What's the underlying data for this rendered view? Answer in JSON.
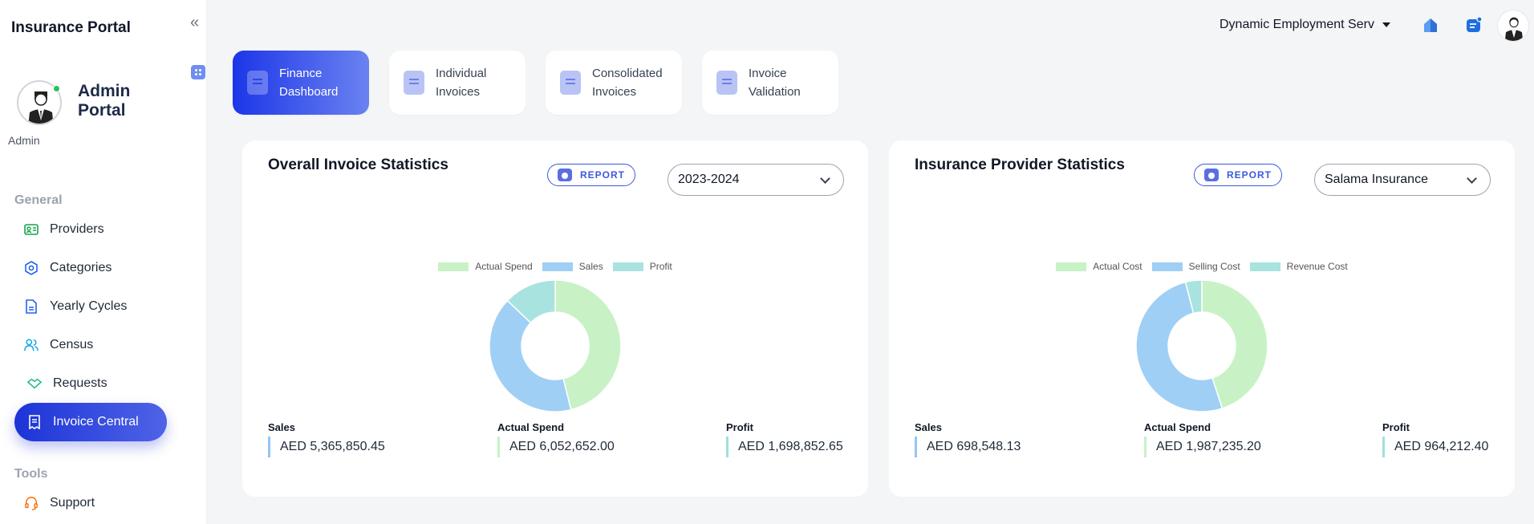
{
  "sidebar": {
    "app_title": "Insurance Portal",
    "user_name": "Admin Portal",
    "user_role": "Admin",
    "sections": [
      {
        "label": "General"
      },
      {
        "label": "Tools"
      }
    ],
    "items": [
      {
        "label": "Providers",
        "icon": "id-card-icon",
        "color": "#16a34a"
      },
      {
        "label": "Categories",
        "icon": "hexagon-icon",
        "color": "#2563eb"
      },
      {
        "label": "Yearly Cycles",
        "icon": "document-icon",
        "color": "#2563eb"
      },
      {
        "label": "Census",
        "icon": "users-icon",
        "color": "#0ea5e9"
      },
      {
        "label": "Requests",
        "icon": "handshake-icon",
        "color": "#10b981"
      },
      {
        "label": "Invoice Central",
        "icon": "invoice-icon",
        "active": true
      },
      {
        "label": "Support",
        "icon": "headset-icon",
        "color": "#f97316"
      }
    ]
  },
  "header": {
    "company": "Dynamic Employment Serv"
  },
  "tabs": [
    {
      "label": "Finance Dashboard",
      "active": true
    },
    {
      "label": "Individual Invoices"
    },
    {
      "label": "Consolidated Invoices"
    },
    {
      "label": "Invoice Validation"
    }
  ],
  "cards": [
    {
      "title": "Overall Invoice Statistics",
      "report_label": "REPORT",
      "select_value": "2023-2024",
      "stats": [
        {
          "label": "Sales",
          "value": "AED 5,365,850.45",
          "color": "#93c5f5"
        },
        {
          "label": "Actual Spend",
          "value": "AED 6,052,652.00",
          "color": "#c8f2c6"
        },
        {
          "label": "Profit",
          "value": "AED 1,698,852.65",
          "color": "#9fe0da"
        }
      ]
    },
    {
      "title": "Insurance Provider Statistics",
      "report_label": "REPORT",
      "select_value": "Salama Insurance",
      "stats": [
        {
          "label": "Sales",
          "value": "AED 698,548.13",
          "color": "#93c5f5"
        },
        {
          "label": "Actual Spend",
          "value": "AED 1,987,235.20",
          "color": "#c8f2c6"
        },
        {
          "label": "Profit",
          "value": "AED 964,212.40",
          "color": "#9fe0da"
        }
      ]
    }
  ],
  "chart_data": [
    {
      "type": "pie",
      "categories": [
        "Actual Spend",
        "Sales",
        "Profit"
      ],
      "values": [
        6052652.0,
        5365850.45,
        1698852.65
      ],
      "colors": [
        "#c8f2c6",
        "#9fcff5",
        "#a8e3df"
      ],
      "legend": "top",
      "donut": true
    },
    {
      "type": "pie",
      "categories": [
        "Actual Cost",
        "Selling Cost",
        "Revenue Cost"
      ],
      "values": [
        1987235.2,
        698548.13,
        964212.4
      ],
      "display_values": [
        45,
        51,
        4
      ],
      "colors": [
        "#c8f2c6",
        "#9fcff5",
        "#a8e3df"
      ],
      "legend": "top",
      "donut": true
    }
  ]
}
